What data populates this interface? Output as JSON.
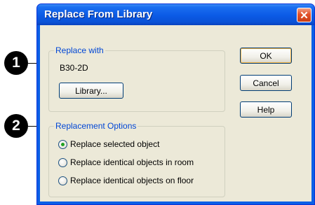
{
  "window": {
    "title": "Replace From Library"
  },
  "callouts": [
    "1",
    "2"
  ],
  "replace_with": {
    "legend": "Replace with",
    "current_value": "B30-2D",
    "library_button": "Library..."
  },
  "replacement_options": {
    "legend": "Replacement Options",
    "options": [
      {
        "label": "Replace selected object",
        "checked": true
      },
      {
        "label": "Replace identical objects in room",
        "checked": false
      },
      {
        "label": "Replace identical objects on floor",
        "checked": false
      }
    ]
  },
  "buttons": {
    "ok": "OK",
    "cancel": "Cancel",
    "help": "Help"
  },
  "colors": {
    "titlebar": "#0a5fe6",
    "legend_text": "#0046d5",
    "client_bg": "#ece9d8",
    "close": "#e2512a"
  }
}
